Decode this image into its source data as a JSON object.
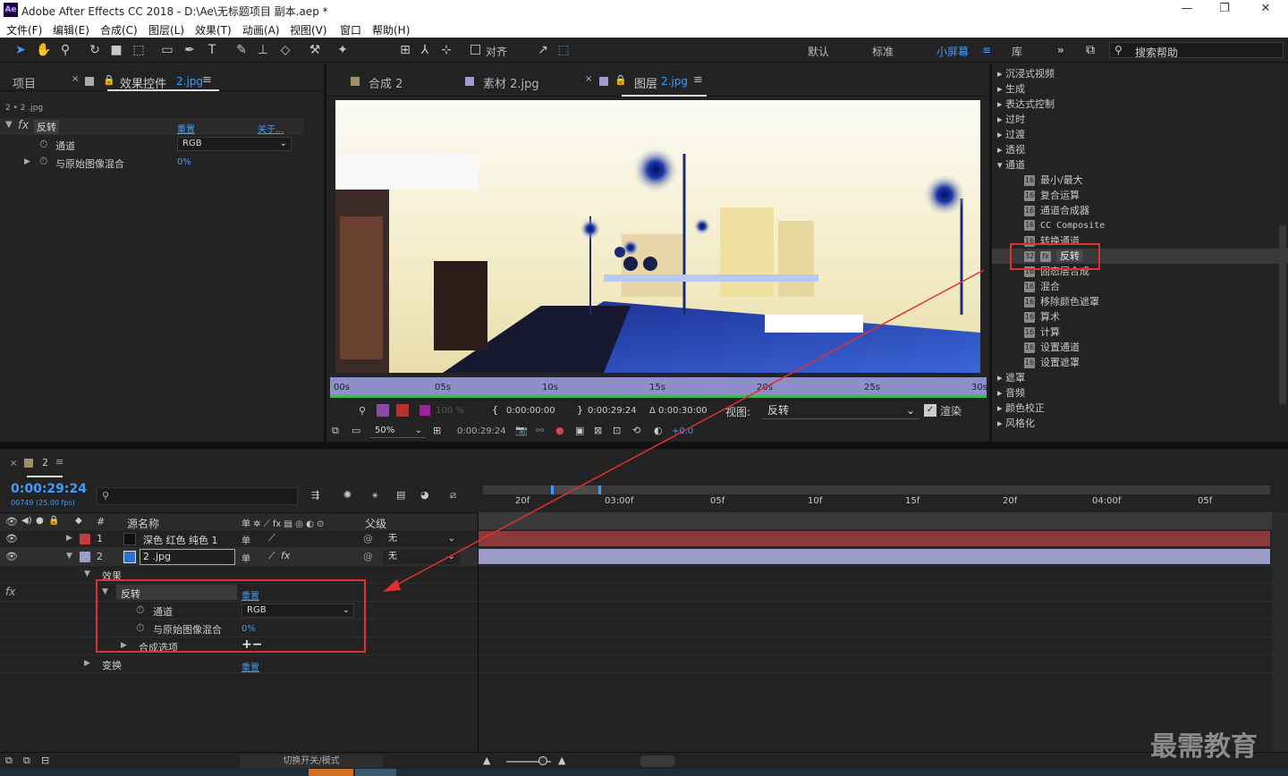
{
  "app": {
    "title": "Adobe After Effects CC 2018 - D:\\Ae\\无标题项目 副本.aep *",
    "logo": "Ae"
  },
  "menu": [
    "文件(F)",
    "编辑(E)",
    "合成(C)",
    "图层(L)",
    "效果(T)",
    "动画(A)",
    "视图(V)",
    "窗口",
    "帮助(H)"
  ],
  "toolbar": {
    "align_label": "对齐",
    "workspaces": [
      "默认",
      "标准",
      "小屏幕",
      "库"
    ],
    "active_workspace": "小屏幕",
    "search_placeholder": "搜索帮助"
  },
  "left_panel": {
    "tab_project": "项目",
    "tab_effects": "效果控件",
    "tab_effects_layer": "2.jpg",
    "subtitle": "2 • 2 .jpg",
    "effect_name": "反转",
    "reset": "重置",
    "about": "关于...",
    "channel_label": "通道",
    "channel_value": "RGB",
    "blend_label": "与原始图像混合",
    "blend_value": "0%"
  },
  "viewer": {
    "tabs": [
      "合成 2",
      "素材 2.jpg",
      "图层 2.jpg"
    ],
    "active_tab_prefix": "图层",
    "active_tab_layer": "2.jpg",
    "ruler": [
      "00s",
      "05s",
      "10s",
      "15s",
      "20s",
      "25s",
      "30s"
    ],
    "percent": "100 %",
    "in_time": "0:00:00:00",
    "out_time": "0:00:29:24",
    "duration": "Δ 0:00:30:00",
    "view_label": "视图:",
    "view_value": "反转",
    "render_label": "渲染",
    "zoom": "50%",
    "current_time": "0:00:29:24",
    "exposure": "+0.0"
  },
  "effects_list": {
    "categories_top": [
      "沉浸式视频",
      "生成",
      "表达式控制",
      "过时",
      "过渡",
      "透视"
    ],
    "open_category": "通道",
    "items": [
      "最小/最大",
      "复合运算",
      "通道合成器",
      "CC Composite",
      "转换通道",
      "反转",
      "固态层合成",
      "混合",
      "移除颜色遮罩",
      "算术",
      "计算",
      "设置通道",
      "设置遮罩"
    ],
    "selected_item": "反转",
    "categories_bottom": [
      "遮罩",
      "音频",
      "颜色校正",
      "风格化"
    ]
  },
  "timeline": {
    "comp_name": "2",
    "timecode": "0:00:29:24",
    "frames": "00749 (25.00 fps)",
    "col_num": "#",
    "col_source": "源名称",
    "col_parent": "父级",
    "ruler": [
      "20f",
      "03:00f",
      "05f",
      "10f",
      "15f",
      "20f",
      "04:00f",
      "05f"
    ],
    "layers": [
      {
        "num": "1",
        "name": "深色 红色 纯色 1",
        "parent": "无",
        "color": "#c8393b"
      },
      {
        "num": "2",
        "name": "2 .jpg",
        "parent": "无",
        "color": "#9c9ccf"
      }
    ],
    "effects_group": "效果",
    "effect_name": "反转",
    "reset": "重置",
    "channel_label": "通道",
    "channel_value": "RGB",
    "blend_label": "与原始图像混合",
    "blend_value": "0%",
    "composite_label": "合成选项",
    "composite_ops": "+−",
    "transform_label": "变换",
    "transform_reset": "重置",
    "toggle_modes": "切换开关/模式"
  },
  "watermark": "最需教育",
  "colors": {
    "accent": "#3f9cff",
    "annotation": "#e03030",
    "track1": "#8b3a3c",
    "track2": "#9c9cc8"
  }
}
